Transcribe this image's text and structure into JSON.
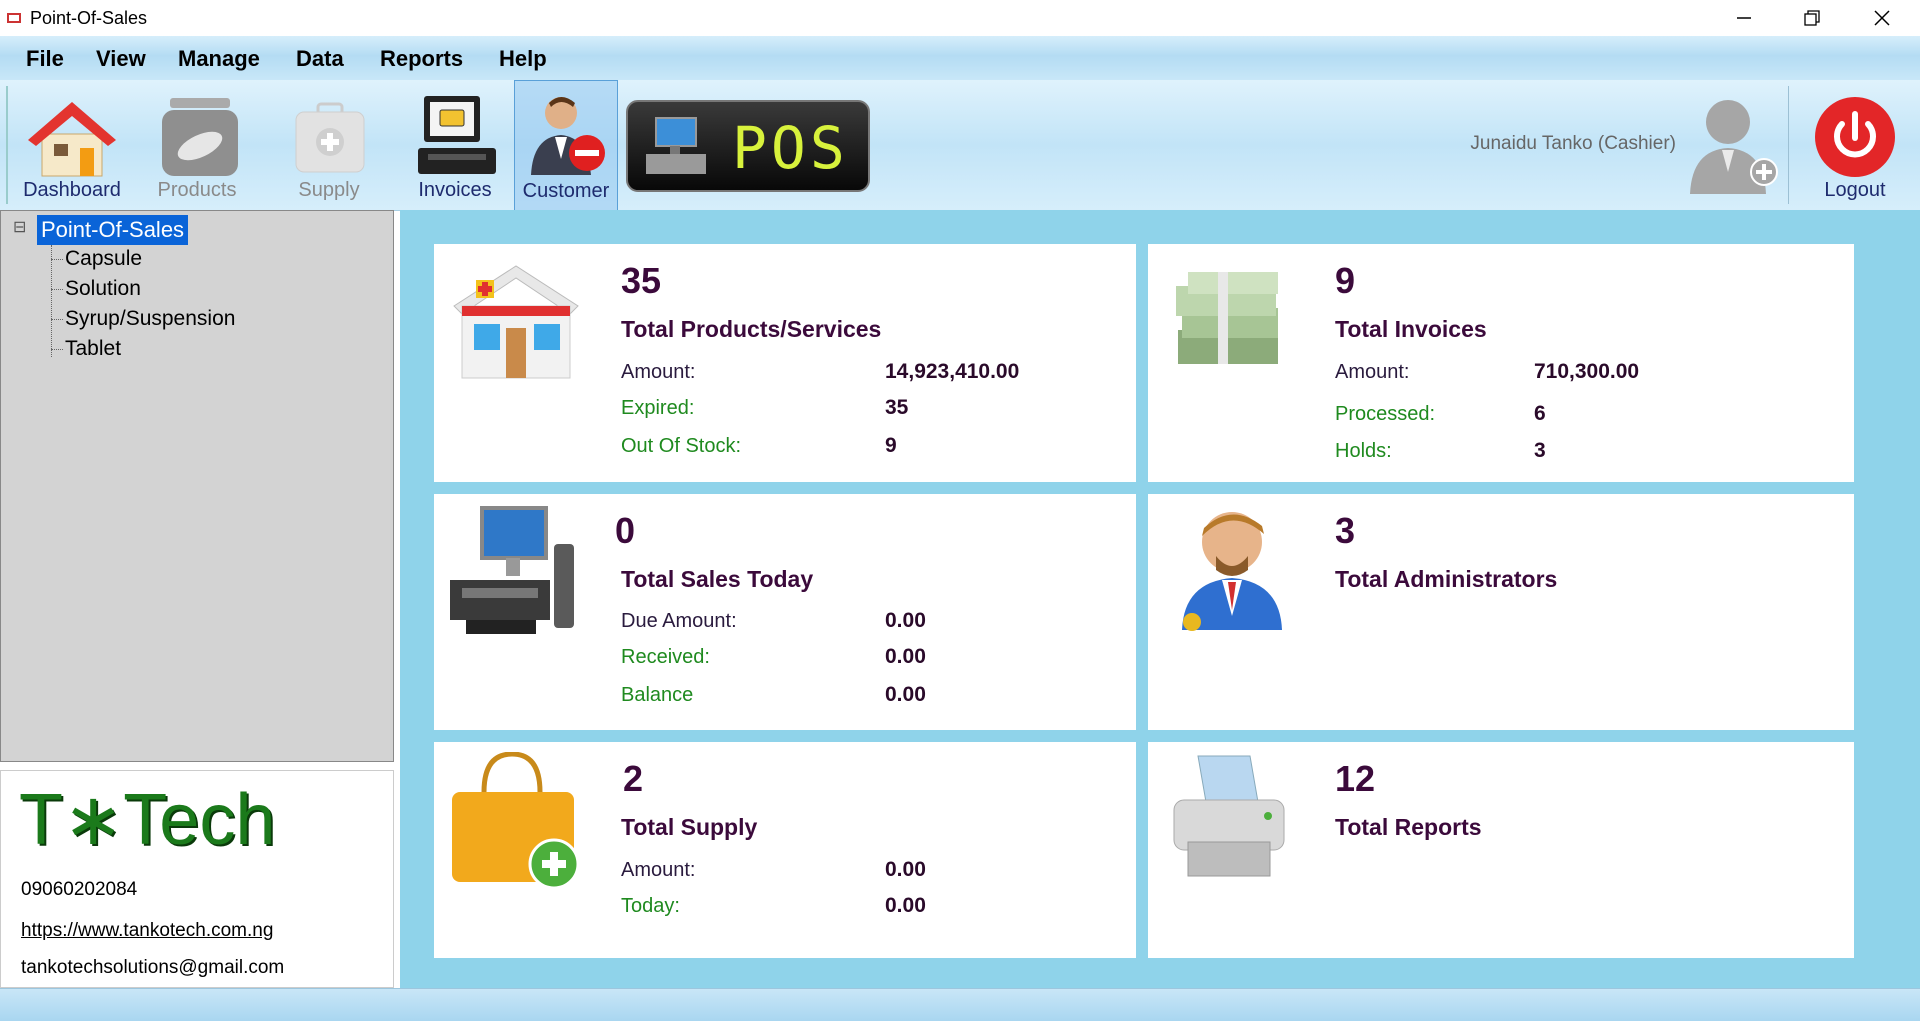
{
  "window": {
    "title": "Point-Of-Sales"
  },
  "menu": [
    "File",
    "View",
    "Manage",
    "Data",
    "Reports",
    "Help"
  ],
  "toolbar": {
    "dashboard": "Dashboard",
    "products": "Products",
    "supply": "Supply",
    "invoices": "Invoices",
    "customer": "Customer",
    "pos_logo_text": "POS",
    "user": "Junaidu Tanko (Cashier)",
    "logout": "Logout"
  },
  "tree": {
    "root": "Point-Of-Sales",
    "expander": "⊟",
    "children": [
      "Capsule",
      "Solution",
      "Syrup/Suspension",
      "Tablet"
    ]
  },
  "brand": {
    "logo_text": "T∗Tech",
    "phone": "09060202084",
    "website": "https://www.tankotech.com.ng",
    "email": "tankotechsolutions@gmail.com"
  },
  "cards": {
    "products": {
      "count": "35",
      "title": "Total Products/Services",
      "rows": [
        {
          "label": "Amount:",
          "value": "14,923,410.00"
        },
        {
          "label": "Expired:",
          "value": "35"
        },
        {
          "label": "Out Of Stock:",
          "value": "9"
        }
      ]
    },
    "invoices": {
      "count": "9",
      "title": "Total Invoices",
      "rows": [
        {
          "label": "Amount:",
          "value": "710,300.00"
        },
        {
          "label": "Processed:",
          "value": "6"
        },
        {
          "label": "Holds:",
          "value": "3"
        }
      ]
    },
    "sales": {
      "count": "0",
      "title": "Total Sales Today",
      "rows": [
        {
          "label": "Due Amount:",
          "value": "0.00"
        },
        {
          "label": "Received:",
          "value": "0.00"
        },
        {
          "label": "Balance",
          "value": "0.00"
        }
      ]
    },
    "admins": {
      "count": "3",
      "title": "Total Administrators"
    },
    "supply": {
      "count": "2",
      "title": "Total Supply",
      "rows": [
        {
          "label": "Amount:",
          "value": "0.00"
        },
        {
          "label": "Today:",
          "value": "0.00"
        }
      ]
    },
    "reports": {
      "count": "12",
      "title": "Total Reports"
    }
  },
  "colors": {
    "main_bg": "#8fd3ea",
    "accent_green": "#1f8a1f",
    "heading": "#3b0a3b",
    "logout_red": "#e32628"
  }
}
